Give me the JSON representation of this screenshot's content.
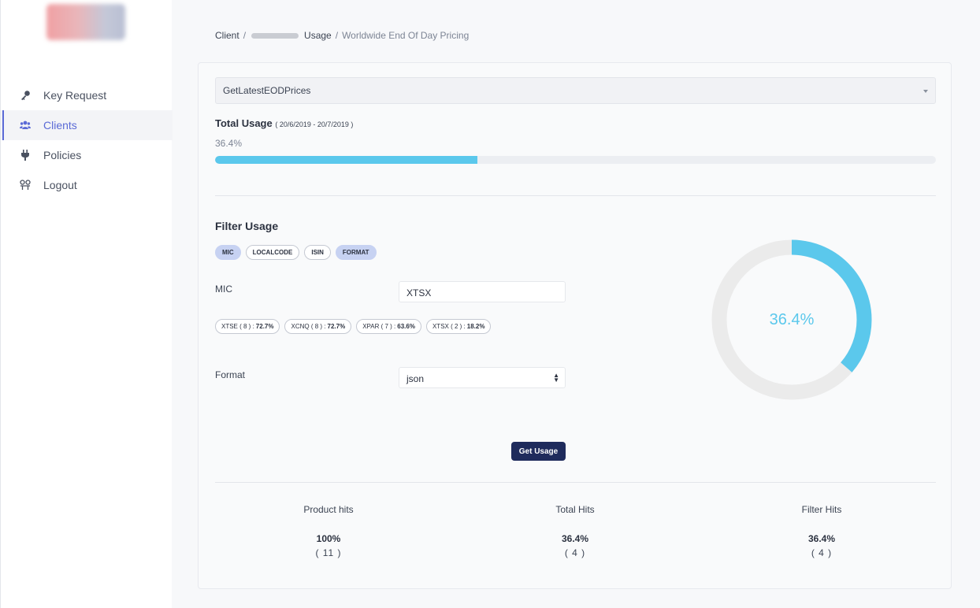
{
  "sidebar": {
    "items": [
      {
        "label": "Key Request",
        "icon": "key-icon"
      },
      {
        "label": "Clients",
        "icon": "users-icon",
        "active": true
      },
      {
        "label": "Policies",
        "icon": "plug-icon"
      },
      {
        "label": "Logout",
        "icon": "logout-icon"
      }
    ]
  },
  "breadcrumb": {
    "client": "Client",
    "sep": "/",
    "usage": "Usage",
    "page": "Worldwide End Of Day Pricing"
  },
  "product_select": {
    "value": "GetLatestEODPrices"
  },
  "total_usage": {
    "title": "Total Usage",
    "range": "( 20/6/2019 - 20/7/2019 )",
    "percent_label": "36.4%",
    "fraction": 0.364
  },
  "filter_usage": {
    "title": "Filter Usage",
    "chips": [
      {
        "label": "MIC",
        "on": true
      },
      {
        "label": "LOCALCODE",
        "on": false
      },
      {
        "label": "ISIN",
        "on": false
      },
      {
        "label": "FORMAT",
        "on": true
      }
    ],
    "mic_label": "MIC",
    "mic_value": "XTSX",
    "mic_stats": [
      {
        "prefix": "XTSE ( 8 ) :",
        "pct": "72.7%"
      },
      {
        "prefix": "XCNQ ( 8 ) :",
        "pct": "72.7%"
      },
      {
        "prefix": "XPAR ( 7 ) :",
        "pct": "63.6%"
      },
      {
        "prefix": "XTSX ( 2 ) :",
        "pct": "18.2%"
      }
    ],
    "format_label": "Format",
    "format_value": "json",
    "button": "Get Usage"
  },
  "donut": {
    "label": "36.4%",
    "fraction": 0.364,
    "color": "#5bc8ec",
    "track_color": "#ebebeb"
  },
  "hits": [
    {
      "title": "Product hits",
      "pct": "100%",
      "count": "( 11 )"
    },
    {
      "title": "Total Hits",
      "pct": "36.4%",
      "count": "( 4 )"
    },
    {
      "title": "Filter Hits",
      "pct": "36.4%",
      "count": "( 4 )"
    }
  ]
}
